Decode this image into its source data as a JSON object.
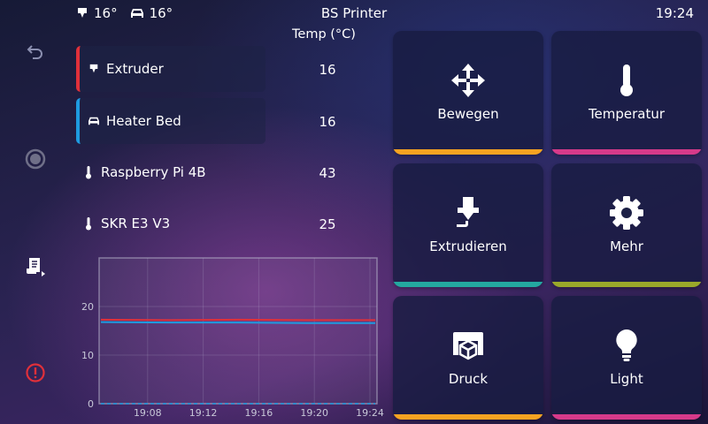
{
  "topbar": {
    "extruder_temp": "16°",
    "bed_temp": "16°",
    "title": "BS Printer",
    "time": "19:24"
  },
  "sidebar": {
    "items": [
      {
        "icon": "back-icon"
      },
      {
        "icon": "emergency-stop-icon"
      },
      {
        "icon": "console-icon"
      },
      {
        "icon": "shutdown-icon"
      }
    ]
  },
  "temperatures": {
    "header": "Temp (°C)",
    "rows": [
      {
        "name": "Extruder",
        "value": "16",
        "icon": "extruder-icon",
        "color": "#e0303a"
      },
      {
        "name": "Heater Bed",
        "value": "16",
        "icon": "bed-icon",
        "color": "#1e9be0"
      },
      {
        "name": "Raspberry Pi 4B",
        "value": "43",
        "icon": "thermometer-icon"
      },
      {
        "name": "SKR E3 V3",
        "value": "25",
        "icon": "thermometer-icon"
      }
    ]
  },
  "chart_data": {
    "type": "line",
    "x_ticks": [
      "19:08",
      "19:12",
      "19:16",
      "19:20",
      "19:24"
    ],
    "y_ticks": [
      "0",
      "10",
      "20"
    ],
    "ylim": [
      0,
      30
    ],
    "grid": true,
    "series": [
      {
        "values": [
          17.3,
          17.2,
          17.3,
          17.2,
          17.2
        ],
        "color": "#e0303a"
      },
      {
        "values": [
          16.8,
          16.7,
          16.7,
          16.6,
          16.6
        ],
        "color": "#1e9be0"
      },
      {
        "values": [
          0,
          0,
          0,
          0,
          0
        ],
        "color": "#1e9be0",
        "dashed": true
      }
    ]
  },
  "tiles": [
    {
      "label": "Bewegen",
      "icon": "move-icon",
      "color": "#f6a321"
    },
    {
      "label": "Temperatur",
      "icon": "thermometer-icon",
      "color": "#d63a8a"
    },
    {
      "label": "Extrudieren",
      "icon": "extrude-icon",
      "color": "#24a8a0"
    },
    {
      "label": "Mehr",
      "icon": "gear-icon",
      "color": "#9aa82a"
    },
    {
      "label": "Druck",
      "icon": "print-icon",
      "color": "#f6a321"
    },
    {
      "label": "Light",
      "icon": "lightbulb-icon",
      "color": "#d63a8a"
    }
  ]
}
